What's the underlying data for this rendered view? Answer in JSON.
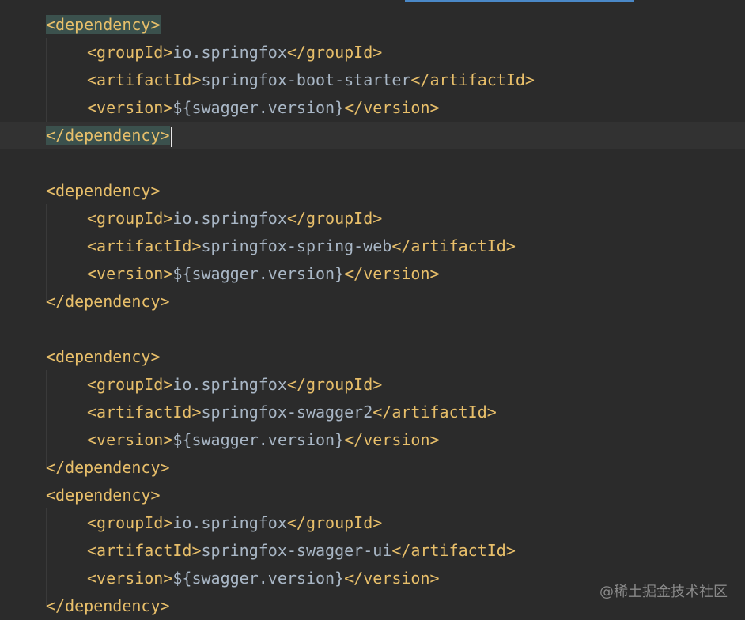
{
  "editor": {
    "lines": [
      {
        "indent": 0,
        "open": "<dependency>",
        "text": "",
        "close": "",
        "match": true,
        "current": false
      },
      {
        "indent": 1,
        "open": "<groupId>",
        "text": "io.springfox",
        "close": "</groupId>"
      },
      {
        "indent": 1,
        "open": "<artifactId>",
        "text": "springfox-boot-starter",
        "close": "</artifactId>"
      },
      {
        "indent": 1,
        "open": "<version>",
        "text": "${swagger.version}",
        "close": "</version>"
      },
      {
        "indent": 0,
        "open": "</dependency>",
        "text": "",
        "close": "",
        "match": true,
        "current": true
      },
      {
        "indent": 0,
        "open": "",
        "text": "",
        "close": ""
      },
      {
        "indent": 0,
        "open": "<dependency>",
        "text": "",
        "close": ""
      },
      {
        "indent": 1,
        "open": "<groupId>",
        "text": "io.springfox",
        "close": "</groupId>"
      },
      {
        "indent": 1,
        "open": "<artifactId>",
        "text": "springfox-spring-web",
        "close": "</artifactId>"
      },
      {
        "indent": 1,
        "open": "<version>",
        "text": "${swagger.version}",
        "close": "</version>"
      },
      {
        "indent": 0,
        "open": "</dependency>",
        "text": "",
        "close": ""
      },
      {
        "indent": 0,
        "open": "",
        "text": "",
        "close": ""
      },
      {
        "indent": 0,
        "open": "<dependency>",
        "text": "",
        "close": ""
      },
      {
        "indent": 1,
        "open": "<groupId>",
        "text": "io.springfox",
        "close": "</groupId>"
      },
      {
        "indent": 1,
        "open": "<artifactId>",
        "text": "springfox-swagger2",
        "close": "</artifactId>"
      },
      {
        "indent": 1,
        "open": "<version>",
        "text": "${swagger.version}",
        "close": "</version>"
      },
      {
        "indent": 0,
        "open": "</dependency>",
        "text": "",
        "close": ""
      },
      {
        "indent": 0,
        "open": "<dependency>",
        "text": "",
        "close": ""
      },
      {
        "indent": 1,
        "open": "<groupId>",
        "text": "io.springfox",
        "close": "</groupId>"
      },
      {
        "indent": 1,
        "open": "<artifactId>",
        "text": "springfox-swagger-ui",
        "close": "</artifactId>"
      },
      {
        "indent": 1,
        "open": "<version>",
        "text": "${swagger.version}",
        "close": "</version>"
      },
      {
        "indent": 0,
        "open": "</dependency>",
        "text": "",
        "close": ""
      }
    ]
  },
  "watermark": "@稀土掘金技术社区",
  "colors": {
    "background": "#2b2b2b",
    "tag": "#e8bf6a",
    "text": "#a9b7c6",
    "tag_match_highlight": "#3b514d",
    "current_line": "#323232"
  }
}
